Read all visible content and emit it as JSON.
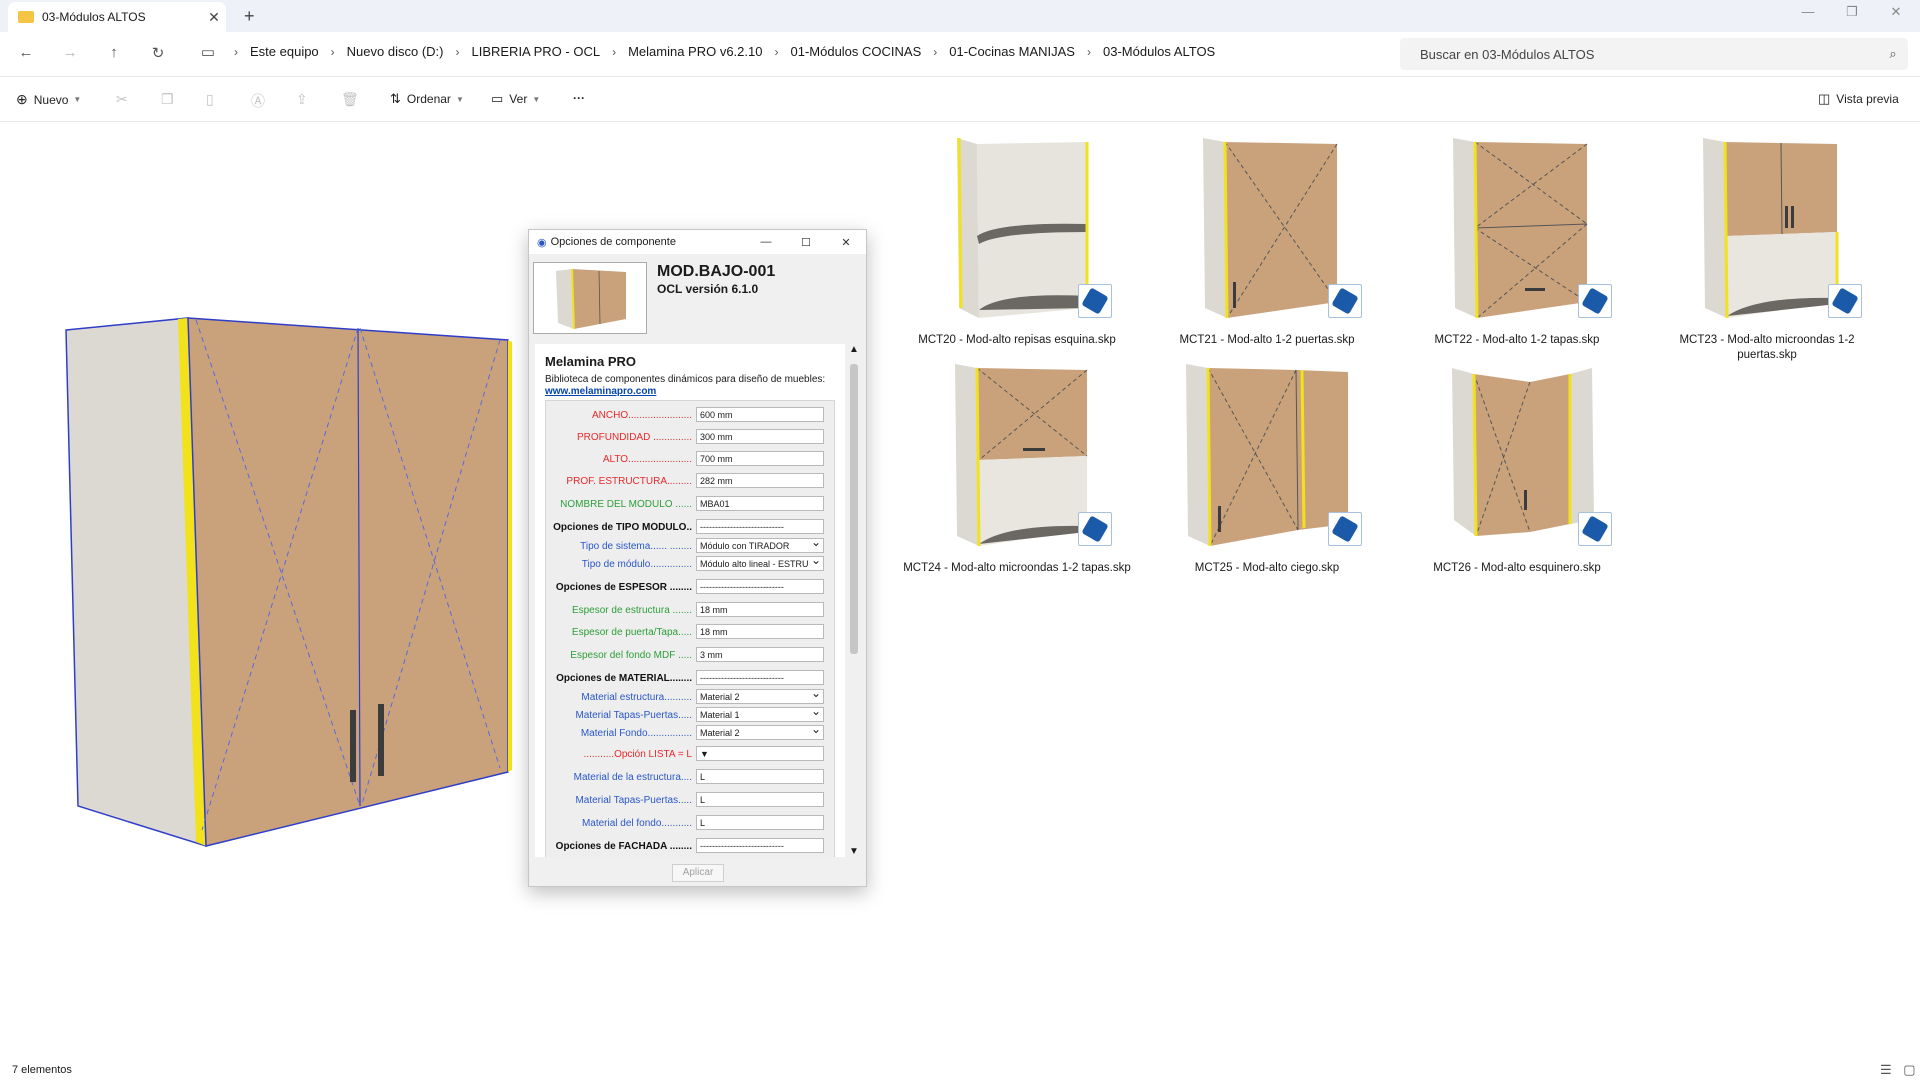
{
  "window": {
    "tab_title": "03-Módulos ALTOS",
    "new_tab": "+",
    "close_tab": "✕",
    "minimize": "—",
    "restore": "❐",
    "close": "✕"
  },
  "address": {
    "crumbs": [
      "Este equipo",
      "Nuevo disco (D:)",
      "LIBRERIA PRO - OCL",
      "Melamina PRO v6.2.10",
      "01-Módulos COCINAS",
      "01-Cocinas MANIJAS",
      "03-Módulos ALTOS"
    ],
    "search_placeholder": "Buscar en 03-Módulos ALTOS"
  },
  "toolbar": {
    "new_label": "Nuevo",
    "sort_label": "Ordenar",
    "view_label": "Ver",
    "more_label": "···",
    "preview_label": "Vista previa"
  },
  "dialog": {
    "title": "Opciones de componente",
    "component_name": "MOD.BAJO-001",
    "version": "OCL versión 6.1.0",
    "section_title": "Melamina PRO",
    "description": "Biblioteca de componentes dinámicos para diseño de muebles:",
    "link": "www.melaminapro.com",
    "fields": [
      {
        "label": "ANCHO.......................",
        "value": "600 mm",
        "color": "red"
      },
      {
        "label": "PROFUNDIDAD ..............",
        "value": "300 mm",
        "color": "red"
      },
      {
        "label": "ALTO.......................",
        "value": "700 mm",
        "color": "red"
      },
      {
        "label": "PROF. ESTRUCTURA.........",
        "value": "282 mm",
        "color": "red"
      },
      {
        "label": "NOMBRE DEL MÓDULO ......",
        "value": "MBA01",
        "color": "green"
      },
      {
        "label": "Opciones de TIPO MÓDULO..",
        "value": "----------------------------",
        "color": "hdr"
      },
      {
        "label": "Tipo de sistema...... ........",
        "value": "Módulo con TIRADOR",
        "color": "blue",
        "select": true
      },
      {
        "label": "Tipo de módulo...............",
        "value": "Módulo alto lineal - ESTRU",
        "color": "blue",
        "select": true
      },
      {
        "label": "Opciones de ESPESOR ........",
        "value": "----------------------------",
        "color": "hdr"
      },
      {
        "label": "Espesor de estructura .......",
        "value": "18 mm",
        "color": "green"
      },
      {
        "label": "Espesor de puerta/Tapa.....",
        "value": "18 mm",
        "color": "green"
      },
      {
        "label": "Espesor del fondo MDF .....",
        "value": "3 mm",
        "color": "green"
      },
      {
        "label": "Opciones de MATERIAL........",
        "value": "----------------------------",
        "color": "hdr"
      },
      {
        "label": "Material estructura..........",
        "value": "Material 2",
        "color": "blue",
        "select": true
      },
      {
        "label": "Material Tapas-Puertas.....",
        "value": "Material 1",
        "color": "blue",
        "select": true
      },
      {
        "label": "Material Fondo................",
        "value": "Material 2",
        "color": "blue",
        "select": true
      },
      {
        "label": "...........Opción LISTA = L",
        "value": "▼",
        "color": "red"
      },
      {
        "label": "Material de la estructura....",
        "value": "L",
        "color": "blue"
      },
      {
        "label": "Material Tapas-Puertas.....",
        "value": "L",
        "color": "blue"
      },
      {
        "label": "Material del fondo...........",
        "value": "L",
        "color": "blue"
      },
      {
        "label": "Opciones de FACHADA ........",
        "value": "----------------------------",
        "color": "hdr"
      }
    ],
    "apply_label": "Aplicar",
    "min": "—",
    "max": "☐",
    "close": "✕"
  },
  "files": [
    {
      "name": "MCT20 - Mod-alto repisas esquina.skp"
    },
    {
      "name": "MCT21 - Mod-alto 1-2 puertas.skp"
    },
    {
      "name": "MCT22 - Mod-alto 1-2 tapas.skp"
    },
    {
      "name": "MCT23 - Mod-alto microondas 1-2 puertas.skp"
    },
    {
      "name": "MCT24 - Mod-alto microondas 1-2 tapas.skp"
    },
    {
      "name": "MCT25 - Mod-alto ciego.skp"
    },
    {
      "name": "MCT26 - Mod-alto esquinero.skp"
    }
  ],
  "status": {
    "count": "7 elementos"
  },
  "colors": {
    "wood": "#c9a27c",
    "carcass": "#d8d5cf",
    "edge": "#f2e21b",
    "outline": "#2f3ec9",
    "link": "#0645ad"
  }
}
